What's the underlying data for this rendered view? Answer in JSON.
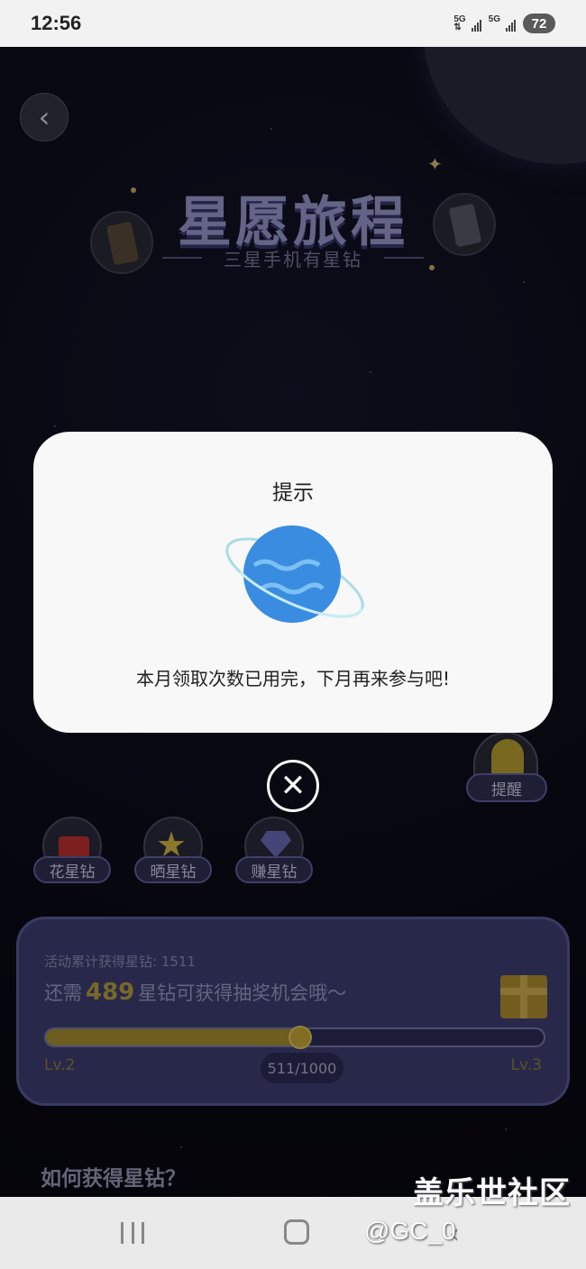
{
  "status_bar": {
    "time": "12:56",
    "net1": "5G",
    "net2": "5G",
    "battery": "72"
  },
  "hero": {
    "title": "星愿旅程",
    "subtitle": "三星手机有星钻"
  },
  "dialog": {
    "title": "提示",
    "message": "本月领取次数已用完，下月再来参与吧!"
  },
  "reminder": {
    "label": "提醒"
  },
  "shortcuts": [
    {
      "label": "花星钻",
      "icon": "shopping-bag-icon"
    },
    {
      "label": "晒星钻",
      "icon": "star-icon"
    },
    {
      "label": "赚星钻",
      "icon": "diamond-icon"
    }
  ],
  "progress": {
    "accumulated_label": "活动累计获得星钻: 1511",
    "need_prefix": "还需",
    "need_value": "489",
    "need_suffix": "星钻可获得抽奖机会哦～",
    "level_left": "Lv.2",
    "level_right": "Lv.3",
    "count": "511/1000",
    "fraction": 0.511
  },
  "section": {
    "how_title": "如何获得星钻？"
  },
  "watermark": {
    "line1": "盖乐世社区",
    "line2": "@GC_0"
  },
  "colors": {
    "accent": "#b8a040",
    "card": "#3e3e72",
    "dialog": "#f8f8f8"
  }
}
